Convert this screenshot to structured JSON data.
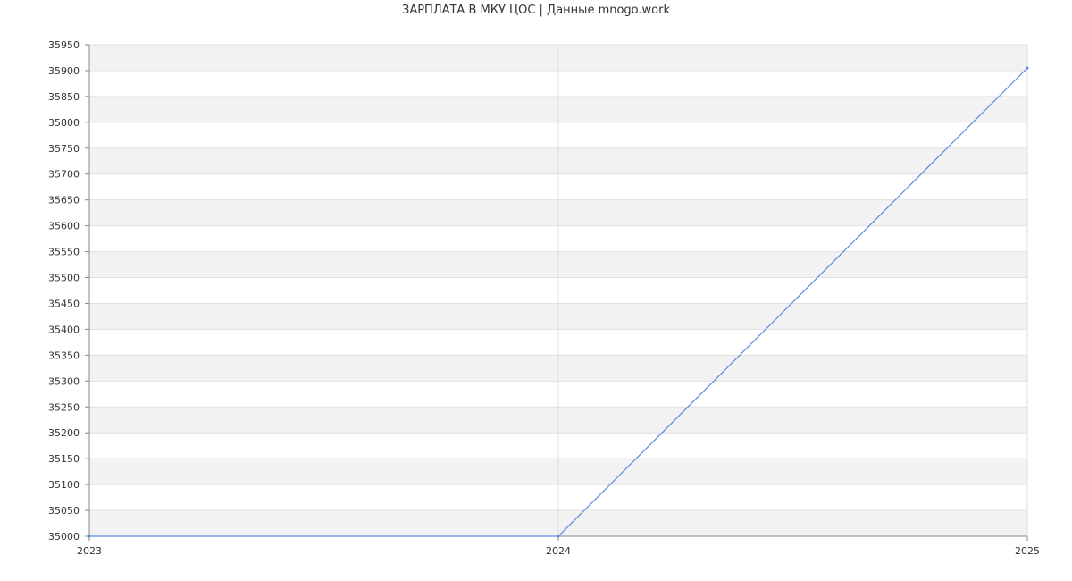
{
  "chart_data": {
    "type": "line",
    "title": "ЗАРПЛАТА В МКУ ЦОС | Данные mnogo.work",
    "xlabel": "",
    "ylabel": "",
    "x": [
      "2023",
      "2024",
      "2025"
    ],
    "series": [
      {
        "values": [
          35000,
          35000,
          35905
        ]
      }
    ],
    "ylim": [
      35000,
      35950
    ],
    "yticks": [
      35000,
      35050,
      35100,
      35150,
      35200,
      35250,
      35300,
      35350,
      35400,
      35450,
      35500,
      35550,
      35600,
      35650,
      35700,
      35750,
      35800,
      35850,
      35900,
      35950
    ],
    "grid": true,
    "legend": "none"
  },
  "colors": {
    "line": "#5b8be0",
    "band": "#f2f2f2",
    "grid": "#e0e0e0",
    "axis": "#888888"
  }
}
